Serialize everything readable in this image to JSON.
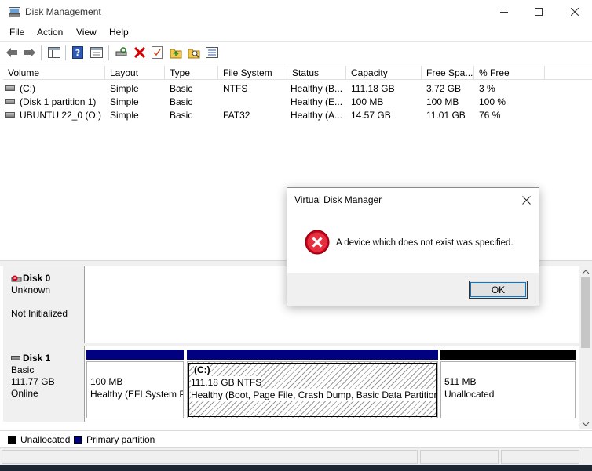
{
  "window": {
    "title": "Disk Management"
  },
  "menu": [
    "File",
    "Action",
    "View",
    "Help"
  ],
  "icons": {
    "app": "disk-management-icon",
    "back": "back-arrow-icon",
    "forward": "forward-arrow-icon",
    "cancel": "red-x-icon",
    "error": "error-circle-icon"
  },
  "volumes": {
    "columns": [
      "Volume",
      "Layout",
      "Type",
      "File System",
      "Status",
      "Capacity",
      "Free Spa...",
      "% Free"
    ],
    "rows": [
      [
        "(C:)",
        "Simple",
        "Basic",
        "NTFS",
        "Healthy (B...",
        "111.18 GB",
        "3.72 GB",
        "3 %"
      ],
      [
        "(Disk 1 partition 1)",
        "Simple",
        "Basic",
        "",
        "Healthy (E...",
        "100 MB",
        "100 MB",
        "100 %"
      ],
      [
        "UBUNTU 22_0 (O:)",
        "Simple",
        "Basic",
        "FAT32",
        "Healthy (A...",
        "14.57 GB",
        "11.01 GB",
        "76 %"
      ]
    ]
  },
  "disks": [
    {
      "name": "Disk 0",
      "line1": "Unknown",
      "line2": "",
      "line3": "Not Initialized"
    },
    {
      "name": "Disk 1",
      "line1": "Basic",
      "line2": "111.77 GB",
      "line3": "Online"
    }
  ],
  "partitions": [
    {
      "title": "",
      "size": "100 MB",
      "status": "Healthy (EFI System P"
    },
    {
      "title": "(C:)",
      "size": "111.18 GB NTFS",
      "status": "Healthy (Boot, Page File, Crash Dump, Basic Data Partition"
    },
    {
      "title": "",
      "size": "511 MB",
      "status": "Unallocated"
    }
  ],
  "legend": {
    "unallocated": "Unallocated",
    "primary": "Primary partition"
  },
  "colors": {
    "primary": "#000080",
    "unallocated": "#000000",
    "error": "#d0021b"
  },
  "dialog": {
    "title": "Virtual Disk Manager",
    "message": "A device which does not exist was specified.",
    "ok": "OK"
  }
}
